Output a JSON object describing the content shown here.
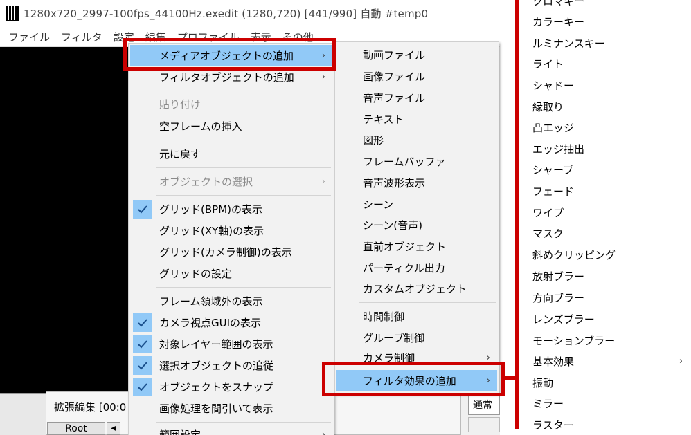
{
  "window": {
    "title": "1280x720_2997-100fps_44100Hz.exedit (1280,720)  [441/990]  自動  #temp0",
    "menubar": [
      "ファイル",
      "フィルタ",
      "設定",
      "編集",
      "プロファイル",
      "表示",
      "その他"
    ]
  },
  "timeline": {
    "title": "拡張編集 [00:0",
    "root_label": "Root",
    "blend_mode": "通常"
  },
  "context_menu": {
    "items": [
      {
        "label": "メディアオブジェクトの追加",
        "submenu": true,
        "highlighted": true
      },
      {
        "label": "フィルタオブジェクトの追加",
        "submenu": true
      },
      {
        "label": "貼り付け",
        "disabled": true
      },
      {
        "label": "空フレームの挿入"
      },
      {
        "label": "元に戻す"
      },
      {
        "label": "オブジェクトの選択",
        "disabled": true,
        "submenu": true
      },
      {
        "label": "グリッド(BPM)の表示",
        "checked": true
      },
      {
        "label": "グリッド(XY軸)の表示"
      },
      {
        "label": "グリッド(カメラ制御)の表示"
      },
      {
        "label": "グリッドの設定"
      },
      {
        "label": "フレーム領域外の表示"
      },
      {
        "label": "カメラ視点GUIの表示",
        "checked": true
      },
      {
        "label": "対象レイヤー範囲の表示",
        "checked": true
      },
      {
        "label": "選択オブジェクトの追従",
        "checked": true
      },
      {
        "label": "オブジェクトをスナップ",
        "checked": true
      },
      {
        "label": "画像処理を間引いて表示"
      },
      {
        "label": "範囲設定",
        "submenu": true
      }
    ]
  },
  "media_submenu": {
    "items": [
      {
        "label": "動画ファイル"
      },
      {
        "label": "画像ファイル"
      },
      {
        "label": "音声ファイル"
      },
      {
        "label": "テキスト"
      },
      {
        "label": "図形"
      },
      {
        "label": "フレームバッファ"
      },
      {
        "label": "音声波形表示"
      },
      {
        "label": "シーン"
      },
      {
        "label": "シーン(音声)"
      },
      {
        "label": "直前オブジェクト"
      },
      {
        "label": "パーティクル出力"
      },
      {
        "label": "カスタムオブジェクト"
      },
      {
        "label": "時間制御"
      },
      {
        "label": "グループ制御"
      },
      {
        "label": "カメラ制御",
        "submenu": true
      },
      {
        "label": "フィルタ効果の追加",
        "submenu": true,
        "highlighted": true
      }
    ]
  },
  "filter_submenu": {
    "items": [
      {
        "label": "クロマキー"
      },
      {
        "label": "カラーキー"
      },
      {
        "label": "ルミナンスキー"
      },
      {
        "label": "ライト"
      },
      {
        "label": "シャドー"
      },
      {
        "label": "縁取り"
      },
      {
        "label": "凸エッジ"
      },
      {
        "label": "エッジ抽出"
      },
      {
        "label": "シャープ"
      },
      {
        "label": "フェード"
      },
      {
        "label": "ワイプ"
      },
      {
        "label": "マスク"
      },
      {
        "label": "斜めクリッピング"
      },
      {
        "label": "放射ブラー"
      },
      {
        "label": "方向ブラー"
      },
      {
        "label": "レンズブラー"
      },
      {
        "label": "モーションブラー"
      },
      {
        "label": "基本効果",
        "submenu": true
      },
      {
        "label": "振動"
      },
      {
        "label": "ミラー"
      },
      {
        "label": "ラスター"
      }
    ]
  },
  "colors": {
    "highlight": "#91c9f7",
    "annotation": "#cc0000"
  }
}
